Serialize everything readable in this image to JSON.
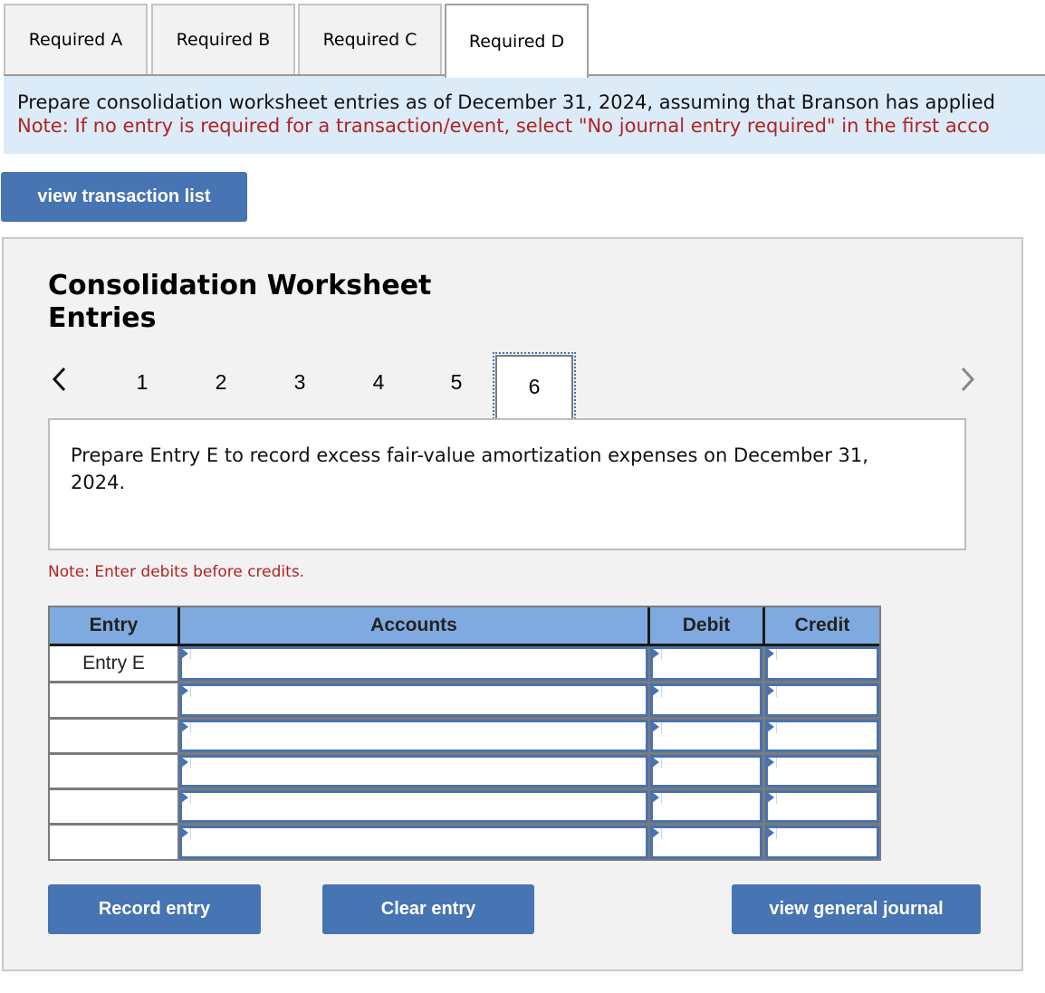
{
  "tabs": [
    {
      "label": "Required A",
      "active": false
    },
    {
      "label": "Required B",
      "active": false
    },
    {
      "label": "Required C",
      "active": false
    },
    {
      "label": "Required D",
      "active": true
    }
  ],
  "banner": {
    "instruction": "Prepare consolidation worksheet entries as of December 31, 2024, assuming that Branson has applied",
    "note": "Note: If no entry is required for a transaction/event, select \"No journal entry required\" in the first acco"
  },
  "view_transaction_list_label": "view transaction list",
  "panel": {
    "title_line1": "Consolidation Worksheet",
    "title_line2": "Entries",
    "pager": {
      "prev_icon": "chevron-left-icon",
      "next_icon": "chevron-right-icon",
      "pages": [
        "1",
        "2",
        "3",
        "4",
        "5",
        "6"
      ],
      "active_page": "6"
    },
    "prompt": "Prepare Entry E to record excess fair-value amortization expenses on December 31, 2024.",
    "note": "Note: Enter debits before credits.",
    "table": {
      "headers": {
        "entry": "Entry",
        "accounts": "Accounts",
        "debit": "Debit",
        "credit": "Credit"
      },
      "rows": [
        {
          "entry": "Entry E",
          "account": "",
          "debit": "",
          "credit": ""
        },
        {
          "entry": "",
          "account": "",
          "debit": "",
          "credit": ""
        },
        {
          "entry": "",
          "account": "",
          "debit": "",
          "credit": ""
        },
        {
          "entry": "",
          "account": "",
          "debit": "",
          "credit": ""
        },
        {
          "entry": "",
          "account": "",
          "debit": "",
          "credit": ""
        },
        {
          "entry": "",
          "account": "",
          "debit": "",
          "credit": ""
        }
      ]
    },
    "buttons": {
      "record": "Record entry",
      "clear": "Clear entry",
      "view_journal": "view general journal"
    }
  },
  "colors": {
    "button_blue": "#4774b2",
    "header_blue": "#7faadf",
    "banner_bg": "#dcebf8",
    "note_red": "#b22222"
  }
}
